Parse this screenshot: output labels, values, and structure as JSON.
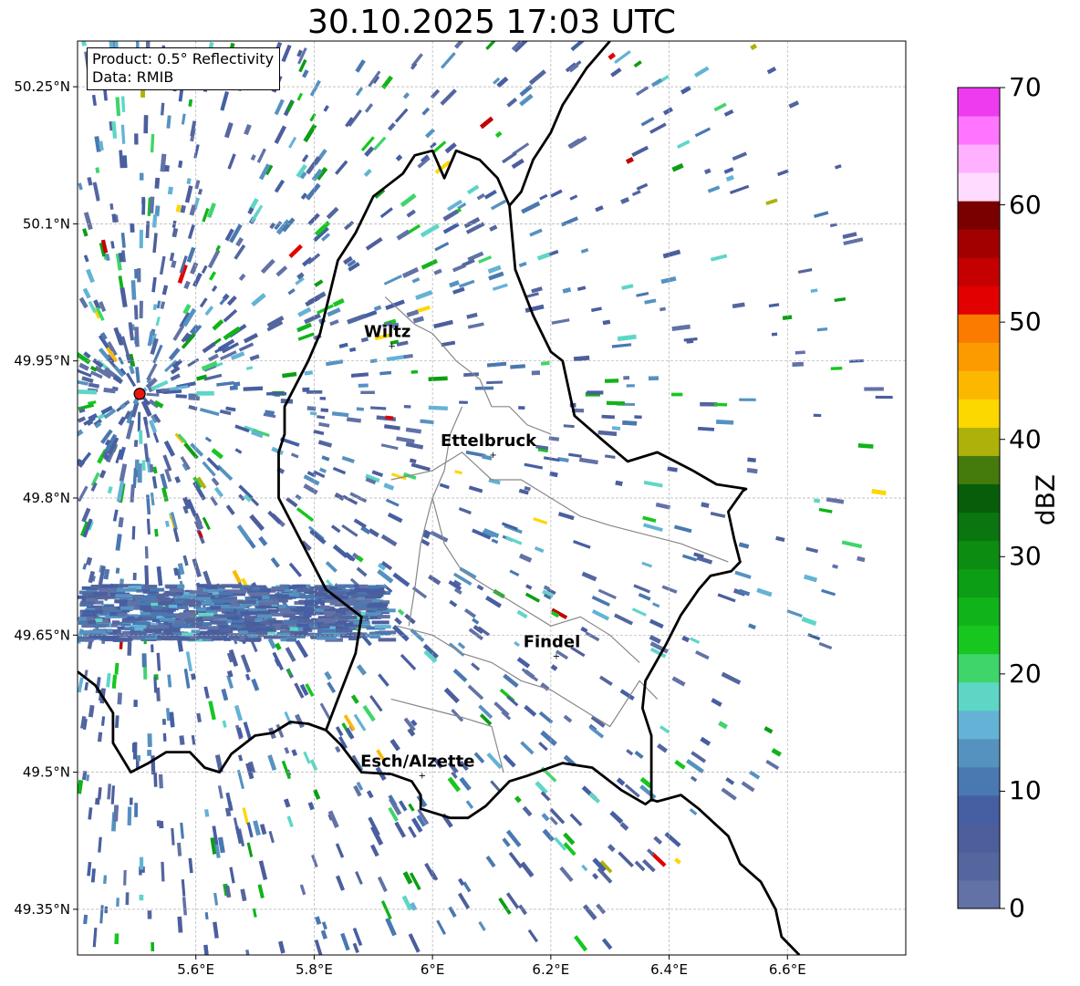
{
  "title": "30.10.2025 17:03 UTC",
  "info": {
    "product": "Product: 0.5° Reflectivity",
    "source": "Data: RMIB"
  },
  "map": {
    "lon_range": [
      5.4,
      6.8
    ],
    "lat_range": [
      49.3,
      50.3
    ],
    "lon_ticks": [
      5.6,
      5.8,
      6.0,
      6.2,
      6.4,
      6.6
    ],
    "lon_tick_labels": [
      "5.6°E",
      "5.8°E",
      "6°E",
      "6.2°E",
      "6.4°E",
      "6.6°E"
    ],
    "lat_ticks": [
      49.35,
      49.5,
      49.65,
      49.8,
      49.95,
      50.1,
      50.25
    ],
    "lat_tick_labels": [
      "49.35°N",
      "49.5°N",
      "49.65°N",
      "49.8°N",
      "49.95°N",
      "50.1°N",
      "50.25°N"
    ],
    "grid": true,
    "radar_site": {
      "lon": 5.505,
      "lat": 49.914
    },
    "cities": [
      {
        "name": "Wiltz",
        "lon": 5.933,
        "lat": 49.966
      },
      {
        "name": "Ettelbruck",
        "lon": 6.104,
        "lat": 49.847
      },
      {
        "name": "Findel",
        "lon": 6.211,
        "lat": 49.627
      },
      {
        "name": "Esch/Alzette",
        "lon": 5.984,
        "lat": 49.496
      }
    ],
    "border": [
      [
        5.4,
        49.61
      ],
      [
        5.43,
        49.595
      ],
      [
        5.46,
        49.565
      ],
      [
        5.46,
        49.532
      ],
      [
        5.49,
        49.5
      ],
      [
        5.52,
        49.51
      ],
      [
        5.55,
        49.522
      ],
      [
        5.59,
        49.522
      ],
      [
        5.615,
        49.505
      ],
      [
        5.64,
        49.5
      ],
      [
        5.66,
        49.52
      ],
      [
        5.7,
        49.54
      ],
      [
        5.73,
        49.543
      ],
      [
        5.76,
        49.555
      ],
      [
        5.79,
        49.553
      ],
      [
        5.82,
        49.546
      ],
      [
        5.845,
        49.53
      ],
      [
        5.88,
        49.5
      ],
      [
        5.93,
        49.498
      ],
      [
        5.965,
        49.49
      ],
      [
        5.98,
        49.475
      ],
      [
        5.98,
        49.46
      ],
      [
        6.03,
        49.45
      ],
      [
        6.06,
        49.45
      ],
      [
        6.09,
        49.463
      ],
      [
        6.13,
        49.49
      ],
      [
        6.16,
        49.496
      ],
      [
        6.22,
        49.51
      ],
      [
        6.27,
        49.505
      ],
      [
        6.32,
        49.48
      ],
      [
        6.36,
        49.465
      ],
      [
        6.37,
        49.47
      ],
      [
        6.38,
        49.468
      ],
      [
        6.42,
        49.475
      ],
      [
        6.45,
        49.46
      ],
      [
        6.5,
        49.43
      ],
      [
        6.52,
        49.4
      ],
      [
        6.555,
        49.38
      ],
      [
        6.58,
        49.35
      ],
      [
        6.59,
        49.32
      ],
      [
        6.62,
        49.3
      ]
    ],
    "border_east": [
      [
        6.37,
        49.468
      ],
      [
        6.37,
        49.54
      ],
      [
        6.355,
        49.57
      ],
      [
        6.36,
        49.6
      ],
      [
        6.395,
        49.64
      ],
      [
        6.42,
        49.672
      ],
      [
        6.45,
        49.7
      ],
      [
        6.47,
        49.715
      ],
      [
        6.505,
        49.72
      ],
      [
        6.52,
        49.73
      ],
      [
        6.51,
        49.755
      ],
      [
        6.5,
        49.785
      ],
      [
        6.525,
        49.808
      ],
      [
        6.53,
        49.81
      ],
      [
        6.48,
        49.815
      ],
      [
        6.44,
        49.83
      ],
      [
        6.41,
        49.84
      ],
      [
        6.38,
        49.85
      ],
      [
        6.33,
        49.84
      ],
      [
        6.29,
        49.862
      ],
      [
        6.24,
        49.89
      ],
      [
        6.23,
        49.92
      ],
      [
        6.22,
        49.95
      ],
      [
        6.2,
        49.96
      ],
      [
        6.17,
        50.0
      ],
      [
        6.14,
        50.05
      ],
      [
        6.13,
        50.12
      ],
      [
        6.11,
        50.15
      ],
      [
        6.08,
        50.17
      ],
      [
        6.04,
        50.18
      ],
      [
        6.02,
        50.15
      ],
      [
        6.0,
        50.18
      ],
      [
        5.97,
        50.175
      ],
      [
        5.95,
        50.155
      ],
      [
        5.9,
        50.13
      ],
      [
        5.87,
        50.09
      ],
      [
        5.85,
        50.07
      ],
      [
        5.84,
        50.06
      ],
      [
        5.81,
        49.98
      ],
      [
        5.79,
        49.95
      ],
      [
        5.75,
        49.9
      ],
      [
        5.75,
        49.87
      ],
      [
        5.74,
        49.85
      ],
      [
        5.74,
        49.8
      ],
      [
        5.78,
        49.75
      ],
      [
        5.82,
        49.7
      ],
      [
        5.88,
        49.67
      ],
      [
        5.87,
        49.63
      ],
      [
        5.84,
        49.58
      ],
      [
        5.82,
        49.546
      ]
    ],
    "border_north": [
      [
        6.13,
        50.12
      ],
      [
        6.15,
        50.135
      ],
      [
        6.17,
        50.17
      ],
      [
        6.2,
        50.2
      ],
      [
        6.22,
        50.23
      ],
      [
        6.26,
        50.27
      ],
      [
        6.3,
        50.3
      ]
    ],
    "cantons": [
      [
        [
          5.92,
          50.02
        ],
        [
          5.97,
          49.99
        ],
        [
          6.0,
          49.98
        ],
        [
          6.04,
          49.95
        ],
        [
          6.08,
          49.93
        ],
        [
          6.1,
          49.9
        ],
        [
          6.13,
          49.9
        ],
        [
          6.16,
          49.88
        ],
        [
          6.2,
          49.87
        ]
      ],
      [
        [
          5.93,
          49.82
        ],
        [
          6.0,
          49.83
        ],
        [
          6.05,
          49.85
        ],
        [
          6.1,
          49.82
        ],
        [
          6.15,
          49.82
        ],
        [
          6.2,
          49.8
        ],
        [
          6.25,
          49.78
        ],
        [
          6.3,
          49.77
        ],
        [
          6.36,
          49.76
        ],
        [
          6.42,
          49.75
        ],
        [
          6.5,
          49.73
        ]
      ],
      [
        [
          6.0,
          49.8
        ],
        [
          6.02,
          49.75
        ],
        [
          6.05,
          49.72
        ],
        [
          6.1,
          49.7
        ],
        [
          6.15,
          49.68
        ],
        [
          6.2,
          49.66
        ],
        [
          6.25,
          49.67
        ],
        [
          6.3,
          49.65
        ],
        [
          6.35,
          49.62
        ]
      ],
      [
        [
          5.94,
          49.66
        ],
        [
          6.0,
          49.65
        ],
        [
          6.05,
          49.63
        ],
        [
          6.1,
          49.62
        ],
        [
          6.15,
          49.6
        ],
        [
          6.2,
          49.59
        ],
        [
          6.25,
          49.57
        ],
        [
          6.3,
          49.55
        ],
        [
          6.35,
          49.6
        ],
        [
          6.38,
          49.58
        ]
      ],
      [
        [
          5.93,
          49.58
        ],
        [
          5.99,
          49.57
        ],
        [
          6.05,
          49.56
        ],
        [
          6.1,
          49.55
        ],
        [
          6.12,
          49.5
        ]
      ],
      [
        [
          6.05,
          49.9
        ],
        [
          6.03,
          49.87
        ],
        [
          6.02,
          49.83
        ],
        [
          6.0,
          49.8
        ],
        [
          5.98,
          49.75
        ],
        [
          5.97,
          49.7
        ],
        [
          5.96,
          49.66
        ]
      ]
    ]
  },
  "colorbar": {
    "label": "dBZ",
    "min": 0,
    "max": 70,
    "ticks": [
      0,
      10,
      20,
      30,
      40,
      50,
      60,
      70
    ],
    "tick_labels": [
      "0",
      "10",
      "20",
      "30",
      "40",
      "50",
      "60",
      "70"
    ],
    "colors": [
      "#6272a6",
      "#54669e",
      "#4c5e9c",
      "#465fa3",
      "#4a78b0",
      "#5692c0",
      "#64b3d6",
      "#5ed6c6",
      "#3fd56b",
      "#17c71f",
      "#11b31a",
      "#0c9e14",
      "#0c8c11",
      "#0b7510",
      "#085d0b",
      "#457a0c",
      "#adb10a",
      "#fdd700",
      "#fcb800",
      "#fc9b00",
      "#fb7a00",
      "#e30000",
      "#c40000",
      "#a20000",
      "#7a0000",
      "#ffdcff",
      "#ffb0ff",
      "#ff75ff",
      "#ee3bef"
    ]
  }
}
